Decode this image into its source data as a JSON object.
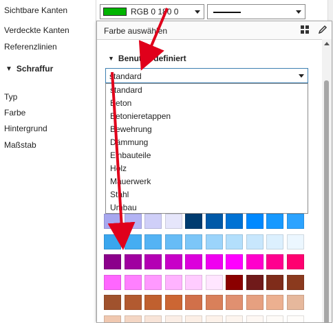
{
  "properties": {
    "sichtbare_kanten": "Sichtbare Kanten",
    "verdeckte_kanten": "Verdeckte Kanten",
    "referenzlinien": "Referenzlinien",
    "schraffur": "Schraffur",
    "typ": "Typ",
    "farbe": "Farbe",
    "hintergrund": "Hintergrund",
    "massstab": "Maßstab"
  },
  "color_combo": {
    "value": "RGB 0 180 0",
    "swatch_color": "#00b400"
  },
  "popup": {
    "title": "Farbe auswählen",
    "section": "Benutzerdefiniert",
    "selected_category": "standard",
    "categories": [
      "standard",
      "Beton",
      "Betonieretappen",
      "Bewehrung",
      "Dämmung",
      "Einbauteile",
      "Holz",
      "Mauerwerk",
      "Stahl",
      "Umbau"
    ],
    "palette_rows": [
      [
        "#a7a7ef",
        "#b3b3f4",
        "#cfcff8",
        "#e6e6fb",
        "#003c70",
        "#0059a8",
        "#0072d4",
        "#0089ff",
        "#1799ff",
        "#2ca3ff"
      ],
      [
        "#3aa6ee",
        "#45adf2",
        "#54b3f4",
        "#67bcf6",
        "#7cc6f8",
        "#9bd4fb",
        "#b3dffc",
        "#c8e7fd",
        "#dcf0fe",
        "#ecf7ff"
      ],
      [
        "#8b008b",
        "#a000a0",
        "#b400b4",
        "#c800c8",
        "#dc00dc",
        "#f000f0",
        "#ff00ff",
        "#ff00cc",
        "#ff008f",
        "#ff0070"
      ],
      [
        "#ff66ff",
        "#ff80ff",
        "#ff99ff",
        "#ffb3ff",
        "#ffccff",
        "#ffe6ff",
        "#8b0000",
        "#701a1a",
        "#7f2c1a",
        "#8b3a1e"
      ],
      [
        "#a0522d",
        "#b25a30",
        "#c0602f",
        "#cc6633",
        "#d1704a",
        "#d9805a",
        "#e09070",
        "#e6a080",
        "#ecb090",
        "#e6b89c"
      ],
      [
        "#f0c8b0",
        "#f4d6c4",
        "#f8e4d8",
        "#fbeee6",
        "#fcefe6",
        "#fdf2ea",
        "#fdf5ef",
        "#fef8f4",
        "#fefbf8",
        "#fffdfb"
      ]
    ]
  },
  "colors": {
    "accent": "#3c7fb1",
    "arrow": "#e0001b"
  }
}
